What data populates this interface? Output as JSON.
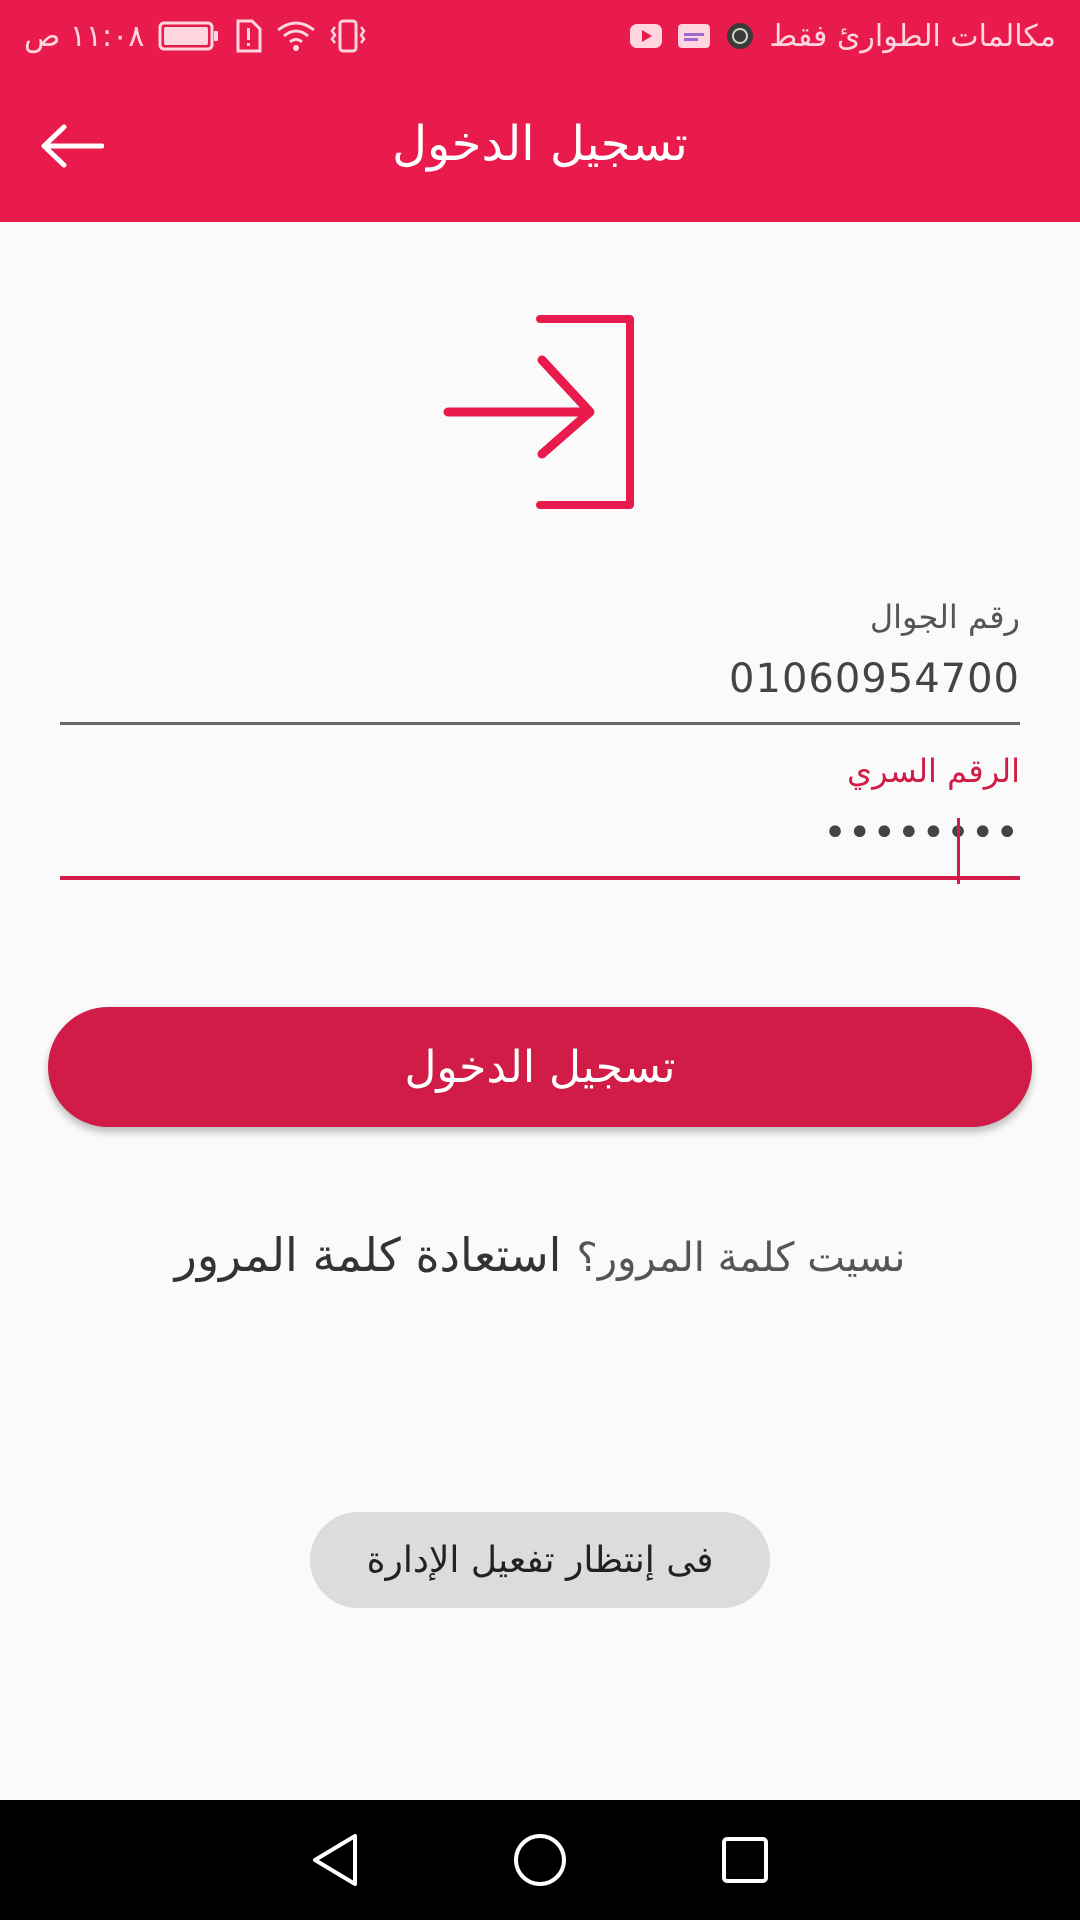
{
  "status_bar": {
    "time": "١١:٠٨ ص",
    "notification_text": "مكالمات الطوارئ فقط",
    "icons": [
      "vibrate-icon",
      "wifi-icon",
      "sim-alert-icon",
      "battery-icon",
      "app-notification-icon",
      "sabq-icon",
      "youtube-icon"
    ]
  },
  "app_bar": {
    "title": "تسجيل الدخول",
    "back_icon": "arrow-left-icon",
    "color": "#e91a4c"
  },
  "login_icon": "login-enter-icon",
  "form": {
    "phone": {
      "label": "رقم الجوال",
      "value": "01060954700"
    },
    "password": {
      "label": "الرقم السري",
      "value": "••••••••"
    }
  },
  "login_button": {
    "label": "تسجيل الدخول",
    "color": "#d01c46"
  },
  "forgot": {
    "question": "نسيت كلمة المرور؟",
    "link": "استعادة كلمة المرور"
  },
  "toast": {
    "message": "فى إنتظار تفعيل الإدارة"
  },
  "nav_bar": {
    "icons": [
      "back-triangle-icon",
      "home-circle-icon",
      "recents-square-icon"
    ]
  }
}
